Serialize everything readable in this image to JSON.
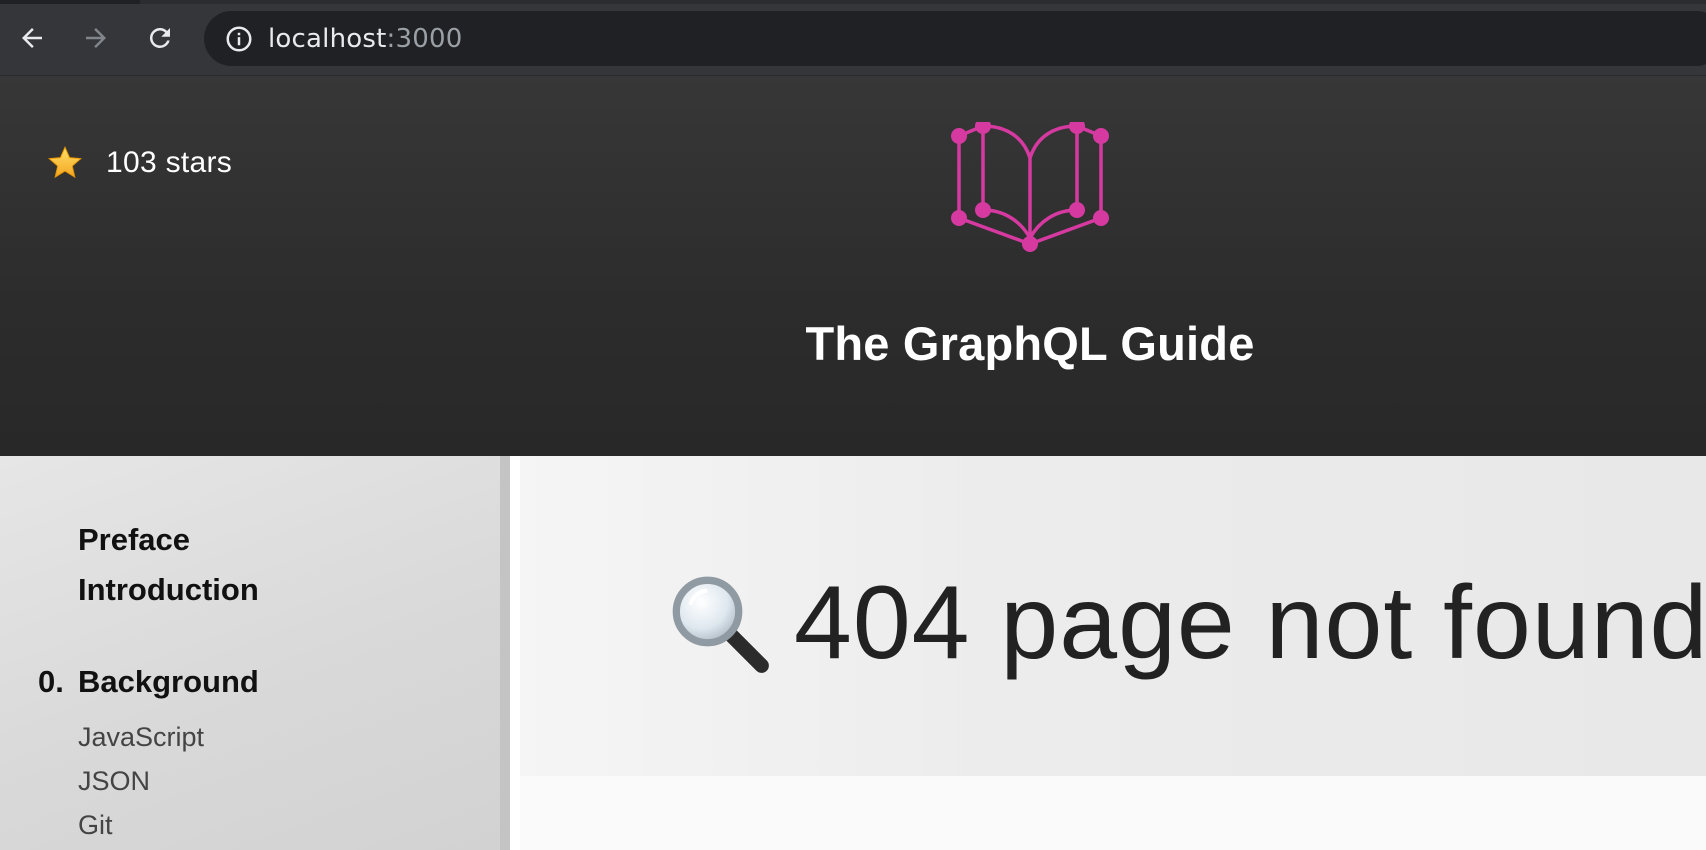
{
  "browser": {
    "url_host": "localhost",
    "url_port": ":3000"
  },
  "header": {
    "stars_label": "103 stars",
    "title": "The GraphQL Guide",
    "logo_color": "#d63aa1"
  },
  "sidebar": {
    "items": [
      {
        "label": "Preface"
      },
      {
        "label": "Introduction"
      }
    ],
    "chapter": {
      "number": "0.",
      "label": "Background"
    },
    "subitems": [
      {
        "label": "JavaScript"
      },
      {
        "label": "JSON"
      },
      {
        "label": "Git"
      }
    ]
  },
  "main": {
    "message": "404 page not found"
  }
}
